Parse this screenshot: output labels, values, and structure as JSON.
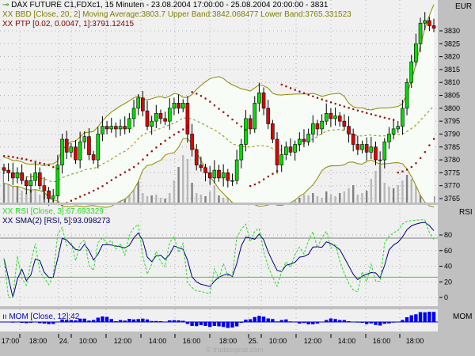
{
  "colors": {
    "up": "#00e000",
    "down": "#e00000",
    "band": "#8b8b00",
    "sar": "#990000",
    "rsi": "#22dd22",
    "sma": "#000080",
    "mom": "#0000ee",
    "volume": "#808080"
  },
  "legend": {
    "title": "DAX FUTURE C1,FDXc1, 15 Minuten - 23.08.2004 17:00:00 - 25.08.2004 20:00:00 - 3831",
    "bbd": "BBD [Close, 20, 2] Moving Average:3803.7 Upper Band:3842.068477 Lower Band:3765.331523",
    "ptp": "PTP [0.02, 0.0047, 1]:3791.12415",
    "rsi": "RSI [Close, 3]:67.693329",
    "sma": "SMA(2) [RSI, 5]:93.098273",
    "mom": "MOM [Close, 12]:42",
    "prefix": "XX"
  },
  "panels": {
    "price_unit": "EUR",
    "rsi": "RSI",
    "mom": "MOM"
  },
  "watermark": "© tradesignal.com",
  "chart_data": {
    "type": "candlestick",
    "title": "DAX FUTURE C1,FDXc1, 15 Minuten",
    "price_axis": {
      "ticks": [
        3765,
        3770,
        3775,
        3780,
        3785,
        3790,
        3795,
        3800,
        3805,
        3810,
        3815,
        3820,
        3825,
        3830
      ],
      "range": [
        3762,
        3838
      ]
    },
    "rsi_axis": {
      "ticks": [
        0,
        20,
        40,
        60,
        80
      ],
      "range": [
        -10,
        118
      ],
      "levels": [
        76,
        26
      ]
    },
    "time_labels": [
      "17:00",
      "18:00",
      "24.",
      "10:00",
      "12:00",
      "14:00",
      "16:00",
      "18:00",
      "25.",
      "10:00",
      "12:00",
      "14:00",
      "16:00",
      "18:00"
    ],
    "closes": [
      3776,
      3775,
      3773,
      3775,
      3772,
      3770,
      3772,
      3775,
      3770,
      3768,
      3765,
      3766,
      3778,
      3788,
      3783,
      3785,
      3780,
      3787,
      3789,
      3782,
      3780,
      3790,
      3793,
      3792,
      3793,
      3792,
      3793,
      3792,
      3796,
      3800,
      3804,
      3799,
      3793,
      3795,
      3798,
      3796,
      3795,
      3800,
      3802,
      3800,
      3802,
      3790,
      3784,
      3778,
      3777,
      3775,
      3773,
      3776,
      3773,
      3775,
      3772,
      3772,
      3780,
      3786,
      3796,
      3792,
      3802,
      3806,
      3800,
      3794,
      3788,
      3778,
      3782,
      3785,
      3783,
      3786,
      3788,
      3787,
      3790,
      3794,
      3792,
      3795,
      3798,
      3796,
      3797,
      3795,
      3793,
      3790,
      3786,
      3784,
      3786,
      3783,
      3785,
      3780,
      3780,
      3787,
      3790,
      3792,
      3793,
      3800,
      3810,
      3818,
      3825,
      3833,
      3834,
      3832,
      3831
    ],
    "volumes": [
      40,
      25,
      20,
      30,
      15,
      12,
      35,
      18,
      10,
      22,
      30,
      8,
      45,
      20,
      15,
      12,
      25,
      10,
      8,
      14,
      18,
      30,
      12,
      8,
      10,
      9,
      6,
      8,
      14,
      22,
      30,
      12,
      8,
      9,
      10,
      6,
      5,
      12,
      28,
      45,
      60,
      55,
      25,
      12,
      10,
      8,
      14,
      22,
      9,
      6,
      10,
      8,
      14,
      16,
      22,
      12,
      18,
      25,
      14,
      10,
      12,
      8,
      9,
      6,
      5,
      8,
      6,
      10,
      9,
      12,
      8,
      6,
      14,
      10,
      8,
      12,
      14,
      18,
      22,
      10,
      12,
      15,
      30,
      40,
      55,
      25,
      20,
      18,
      22,
      28,
      35,
      30,
      22,
      18,
      12,
      10,
      8
    ],
    "bollinger": {
      "period": 20,
      "deviations": 2
    },
    "sar": {
      "start": 0.02,
      "step": 0.0047,
      "max": 1
    },
    "rsi_period": 3,
    "sma_rsi": {
      "period": 2,
      "rsi_period": 5
    },
    "mom_period": 12
  }
}
